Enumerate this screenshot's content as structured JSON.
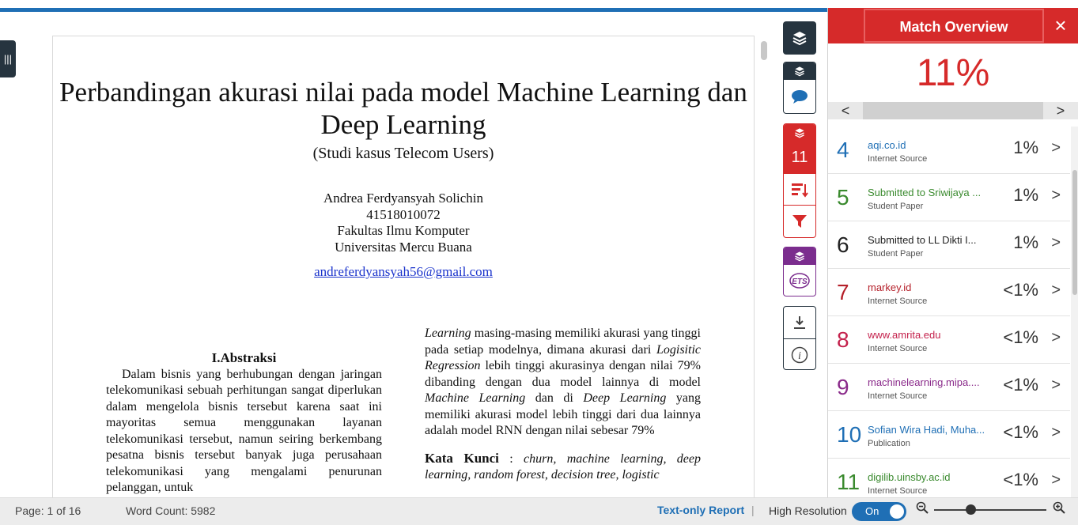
{
  "document": {
    "title": "Perbandingan akurasi nilai pada model Machine Learning dan Deep Learning",
    "subtitle": "(Studi kasus Telecom Users)",
    "author_name": "Andrea Ferdyansyah Solichin",
    "author_id": "41518010072",
    "faculty": "Fakultas Ilmu Komputer",
    "university": "Universitas Mercu Buana",
    "email": "andreferdyansyah56@gmail.com",
    "abstract_heading": "I.Abstraksi",
    "abstract_text": "Dalam bisnis yang berhubungan dengan jaringan telekomunikasi sebuah perhitungan sangat diperlukan dalam mengelola bisnis tersebut karena saat ini mayoritas semua menggunakan layanan telekomunikasi tersebut, namun seiring berkembang pesatna bisnis tersebut banyak juga perusahaan telekomunikasi yang mengalami penurunan pelanggan, untuk",
    "right_col_p1_a": "Learning",
    "right_col_p1_b": " masing-masing memiliki akurasi yang tinggi pada setiap modelnya, dimana akurasi dari ",
    "right_col_p1_c": "Logisitic Regression",
    "right_col_p1_d": " lebih tinggi akurasinya dengan nilai 79% dibanding dengan dua model lainnya di model ",
    "right_col_p1_e": "Machine Learning",
    "right_col_p1_f": " dan di ",
    "right_col_p1_g": "Deep Learning",
    "right_col_p1_h": " yang memiliki akurasi model lebih tinggi dari dua lainnya adalah model RNN dengan nilai sebesar 79%",
    "keywords_label": "Kata Kunci",
    "keywords_sep": " : ",
    "keywords": "churn, machine learning, deep learning, random forest, decision tree, logistic"
  },
  "tools": {
    "red_count": "11"
  },
  "panel": {
    "title": "Match Overview",
    "score": "11%",
    "prev": "<",
    "next": ">",
    "close": "×",
    "sources": [
      {
        "num": "4",
        "name": "aqi.co.id",
        "type": "Internet Source",
        "pct": "1%",
        "color": "#1f6fb5"
      },
      {
        "num": "5",
        "name": "Submitted to Sriwijaya ...",
        "type": "Student Paper",
        "pct": "1%",
        "color": "#3a8a2e"
      },
      {
        "num": "6",
        "name": "Submitted to LL Dikti I...",
        "type": "Student Paper",
        "pct": "1%",
        "color": "#222222"
      },
      {
        "num": "7",
        "name": "markey.id",
        "type": "Internet Source",
        "pct": "<1%",
        "color": "#b5202a"
      },
      {
        "num": "8",
        "name": "www.amrita.edu",
        "type": "Internet Source",
        "pct": "<1%",
        "color": "#c4214c"
      },
      {
        "num": "9",
        "name": "machinelearning.mipa....",
        "type": "Internet Source",
        "pct": "<1%",
        "color": "#8a2a8a"
      },
      {
        "num": "10",
        "name": "Sofian Wira Hadi, Muha...",
        "type": "Publication",
        "pct": "<1%",
        "color": "#1f6fb5"
      },
      {
        "num": "11",
        "name": "digilib.uinsby.ac.id",
        "type": "Internet Source",
        "pct": "<1%",
        "color": "#3a8a2e"
      }
    ]
  },
  "status": {
    "page_info": "Page: 1 of 16",
    "word_count": "Word Count: 5982",
    "text_only": "Text-only Report",
    "separator": "|",
    "high_res": "High Resolution",
    "toggle": "On"
  }
}
